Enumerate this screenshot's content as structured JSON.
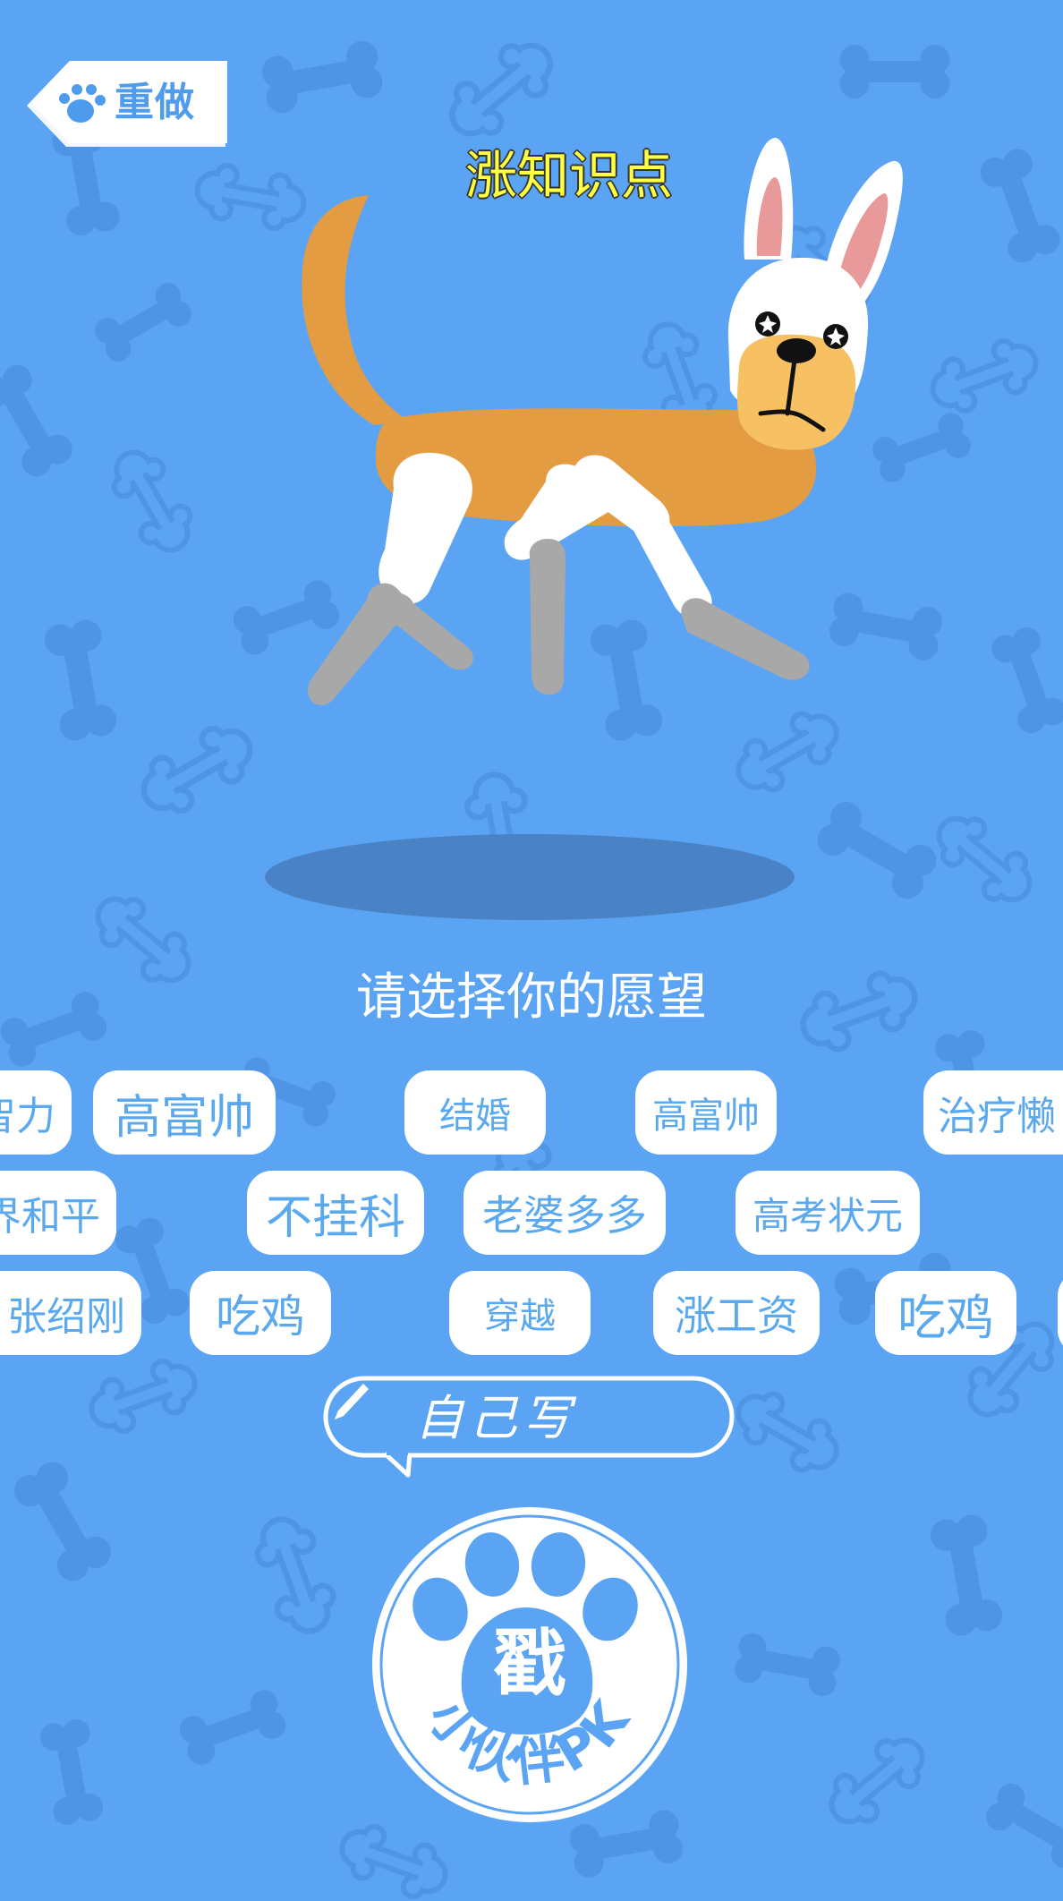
{
  "header": {
    "redo_label": "重做",
    "knowledge_link": "涨知识点"
  },
  "prompt": "请选择你的愿望",
  "wish_chips": [
    {
      "label": "智力",
      "size": 44
    },
    {
      "label": "高富帅",
      "size": 52
    },
    {
      "label": "结婚",
      "size": 40
    },
    {
      "label": "高富帅",
      "size": 40
    },
    {
      "label": "治疗懒",
      "size": 44
    },
    {
      "label": "世界和平",
      "size": 44
    },
    {
      "label": "不挂科",
      "size": 52
    },
    {
      "label": "老婆多多",
      "size": 46
    },
    {
      "label": "高考状元",
      "size": 42
    },
    {
      "label": "张绍刚",
      "size": 44
    },
    {
      "label": "吃鸡",
      "size": 50
    },
    {
      "label": "穿越",
      "size": 40
    },
    {
      "label": "涨工资",
      "size": 46
    },
    {
      "label": "吃鸡",
      "size": 54
    },
    {
      "label": "",
      "size": 44
    }
  ],
  "self_write": {
    "label": "自己写",
    "icon": "pen-icon"
  },
  "logo": {
    "center_char": "戳",
    "arc_text": "小伙伴PK"
  },
  "colors": {
    "background": "#5ba4f3",
    "bone_pattern": "#4f95e6",
    "chip_text": "#5aa8ee",
    "title_yellow": "#ffff44",
    "dog_orange": "#e49c42",
    "dog_muzzle": "#f6c063",
    "dog_grey": "#a8a8a8"
  }
}
